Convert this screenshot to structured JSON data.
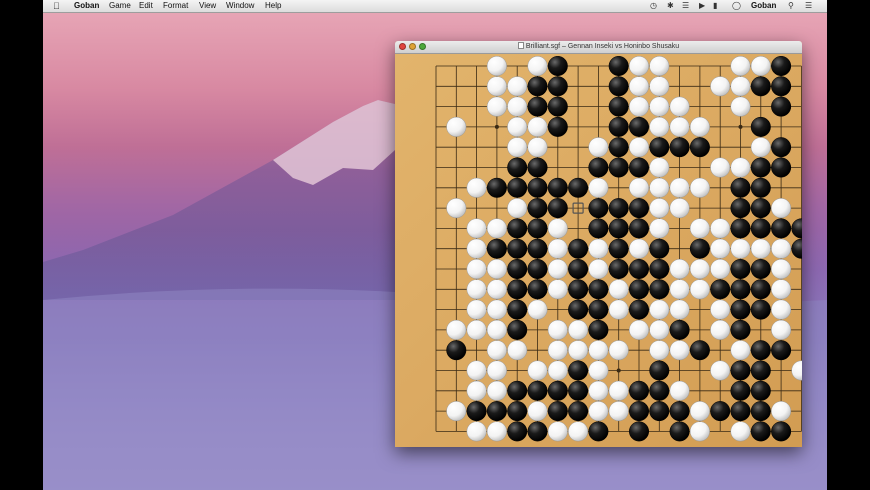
{
  "menubar": {
    "apple_icon": "apple-logo-icon",
    "app_name": "Goban",
    "menus": [
      "Game",
      "Edit",
      "Format",
      "View",
      "Window",
      "Help"
    ],
    "status_icons": [
      "time-machine-icon",
      "bluetooth-icon",
      "wifi-icon",
      "volume-icon",
      "battery-icon",
      "clock-icon"
    ],
    "user": "Goban",
    "search_icon": "spotlight-icon",
    "list_icon": "notification-center-icon"
  },
  "window": {
    "title": "Brilliant.sgf – Gennan Inseki vs Honinbo Shusaku",
    "doc_icon": "sgf-document-icon"
  },
  "board": {
    "size": 19,
    "rows": [
      "...W.WB..BWW...WWB.",
      "...WWBB..BWW..WWBB.",
      "...WWBB..BWWW..W.B.",
      ".W..WWB..BBWWW..B..",
      "....WW..WBWBBB..WB.",
      "....BB..BBBW..WWBB.",
      "..WBBBBBW.WWWW.BB..",
      ".W..WBB.BBBWW..BBW.",
      "..WWBBW.BBBW.WWBBBB",
      "..WBBBWBWBWB.BWWWWB",
      "..WWBBWBWBBBWWWBBW.",
      "..WWBBWBBWBBWWBBBW.",
      "..WWBW.BBWBWW.WBBW.",
      ".WWWB.WWB.WWB.WB.W.",
      ".B.WW.WWWW.WWB.WBB.",
      "..WW.WWBW..B..WBB.W",
      "..WWBBBBWWBBW..BB..",
      ".WBBBWBBWWBBBWBBBW.",
      "..WWBBWWB.B.BW.WBB."
    ],
    "last_move": "H12",
    "colors": {
      "wood": "#dba961",
      "line": "#3a2a14",
      "black_stone": "#1a1a1a",
      "white_stone": "#f3f3f3"
    }
  }
}
